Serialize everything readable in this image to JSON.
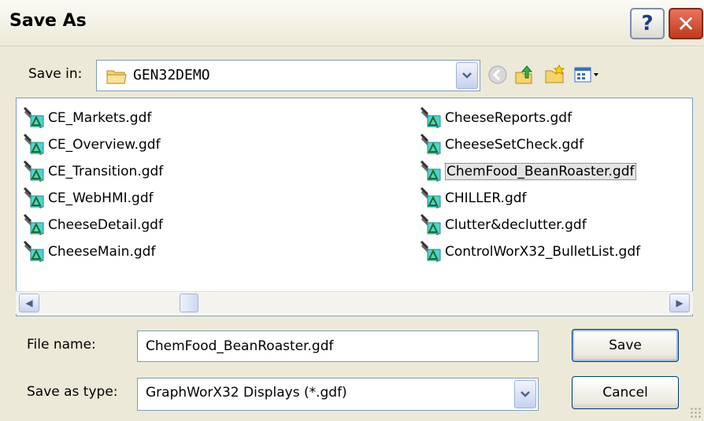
{
  "window": {
    "title": "Save As"
  },
  "toolbar": {
    "save_in_label": "Save in:",
    "location": "GEN32DEMO",
    "icons": [
      "back-icon",
      "up-folder-icon",
      "new-folder-icon",
      "view-menu-icon"
    ]
  },
  "files": [
    {
      "name": "CE_Markets.gdf"
    },
    {
      "name": "CE_Overview.gdf"
    },
    {
      "name": "CE_Transition.gdf"
    },
    {
      "name": "CE_WebHMI.gdf"
    },
    {
      "name": "CheeseDetail.gdf"
    },
    {
      "name": "CheeseMain.gdf"
    },
    {
      "name": "CheeseReports.gdf"
    },
    {
      "name": "CheeseSetCheck.gdf"
    },
    {
      "name": "ChemFood_BeanRoaster.gdf",
      "selected": true
    },
    {
      "name": "CHILLER.gdf"
    },
    {
      "name": "Clutter&declutter.gdf"
    },
    {
      "name": "ControlWorX32_BulletList.gdf"
    }
  ],
  "form": {
    "file_name_label": "File name:",
    "file_name_value": "ChemFood_BeanRoaster.gdf",
    "save_type_label": "Save as type:",
    "save_type_value": "GraphWorX32 Displays (*.gdf)"
  },
  "buttons": {
    "save": "Save",
    "cancel": "Cancel",
    "help": "?"
  },
  "colors": {
    "accent": "#003c74",
    "close": "#c0391c"
  }
}
